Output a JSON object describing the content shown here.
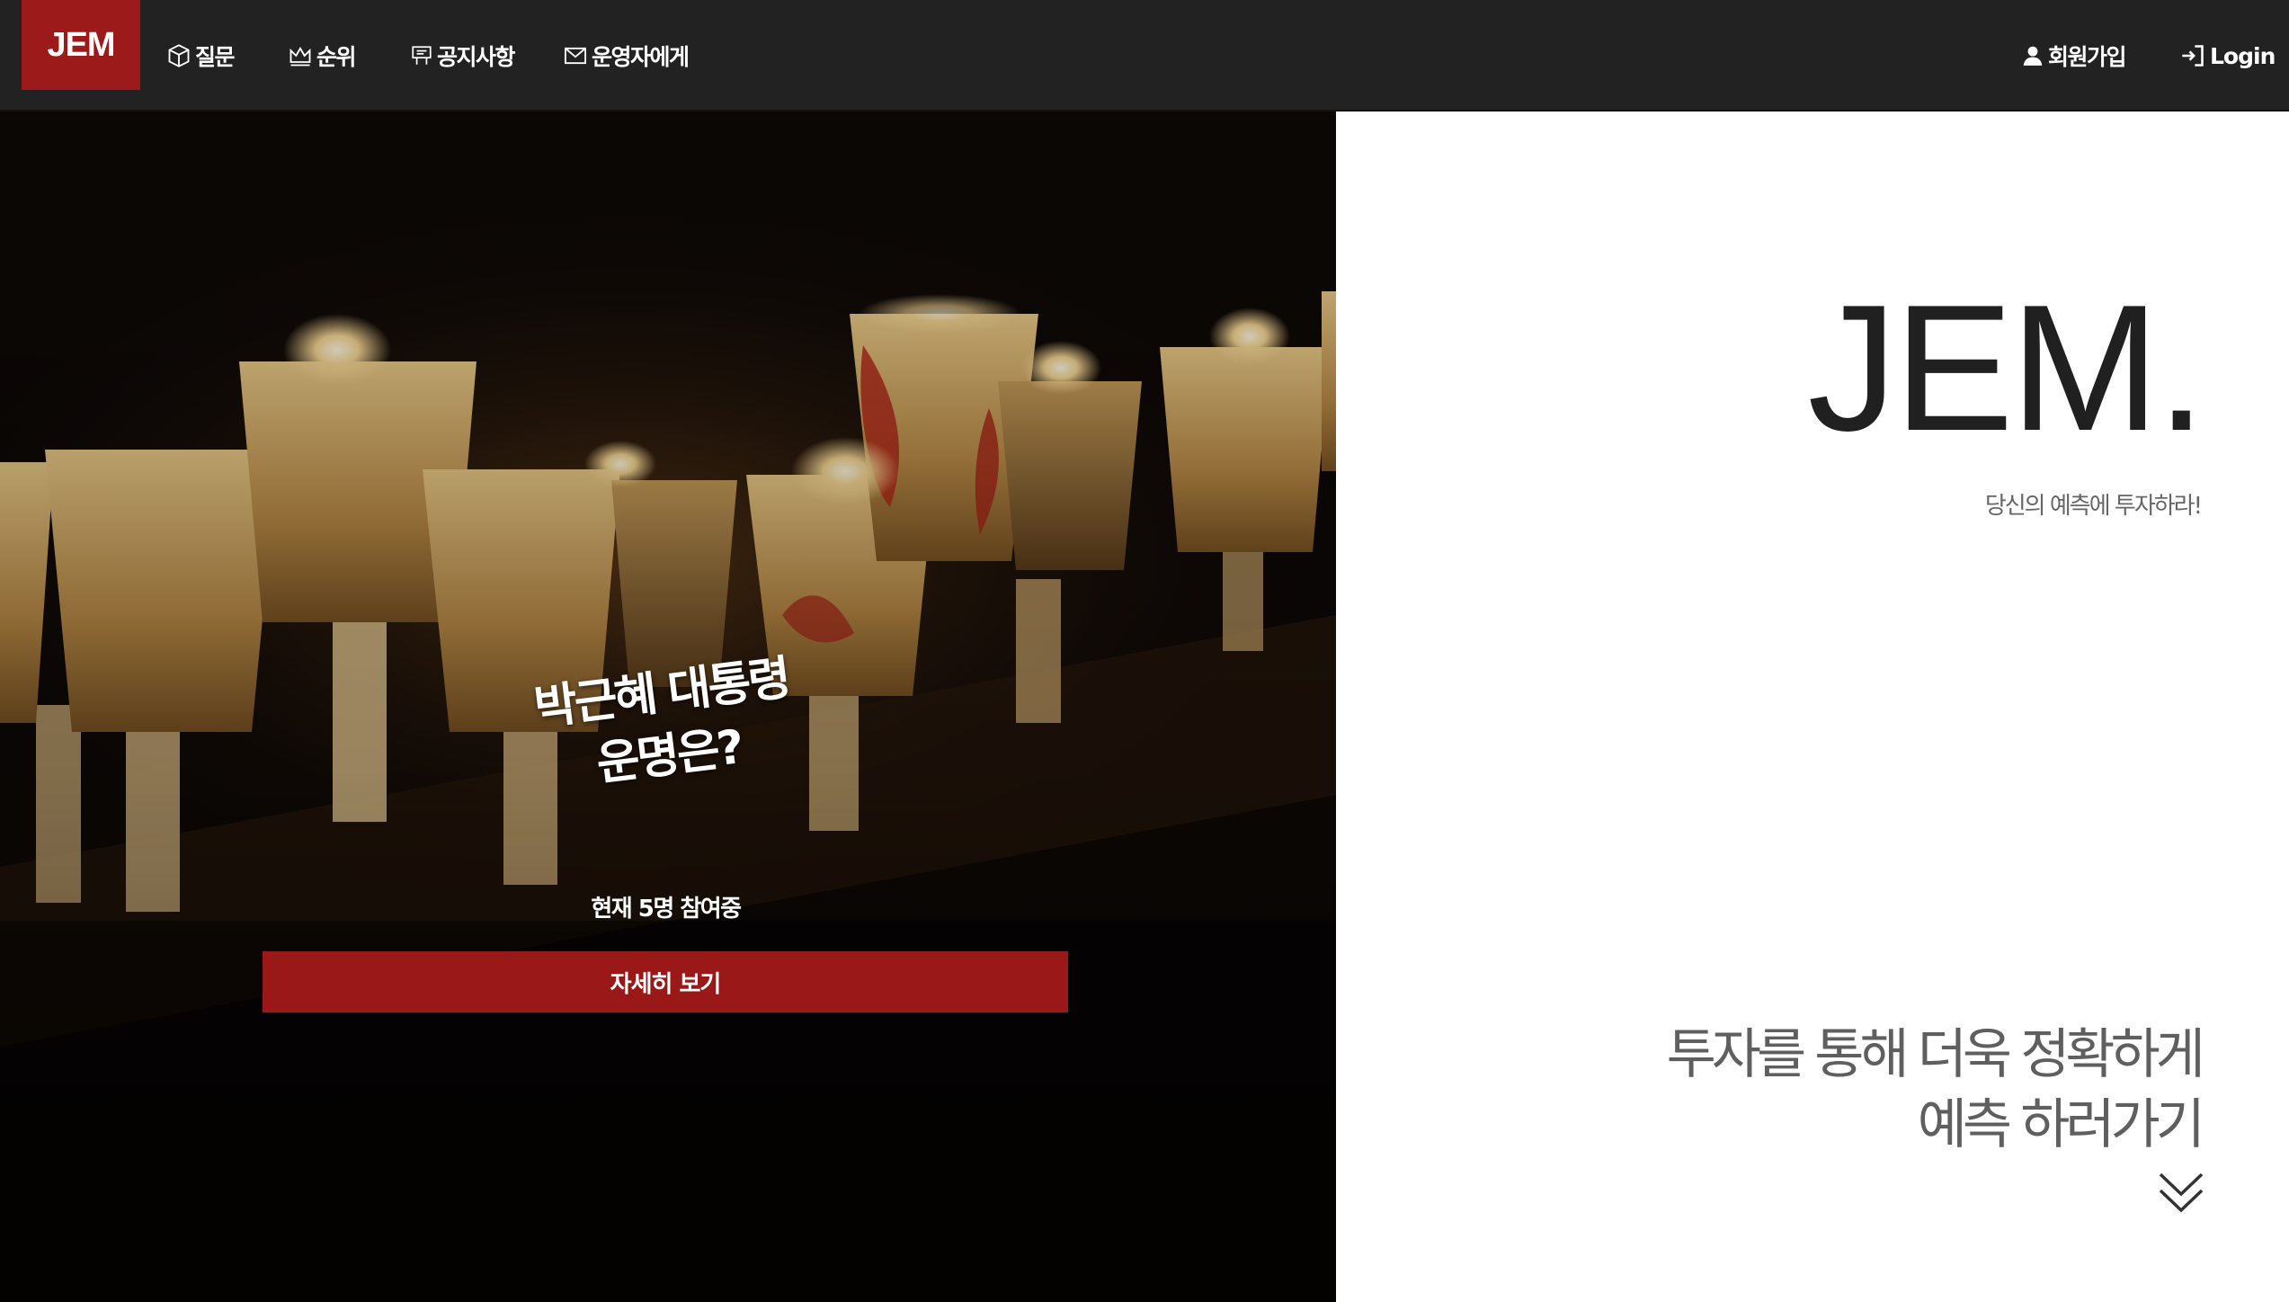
{
  "nav": {
    "brand": "JEM",
    "items": [
      {
        "icon": "cube-icon",
        "label": "질문"
      },
      {
        "icon": "crown-icon",
        "label": "순위"
      },
      {
        "icon": "noticeboard-icon",
        "label": "공지사항"
      },
      {
        "icon": "envelope-icon",
        "label": "운영자에게"
      }
    ],
    "signup": {
      "icon": "user-icon",
      "label": "회원가입"
    },
    "login": {
      "icon": "login-icon",
      "label": "Login"
    }
  },
  "hero": {
    "title_line1": "박근혜 대통령",
    "title_line2": "운명은?",
    "participants": "현재 5명 참여중",
    "button_label": "자세히 보기"
  },
  "panel": {
    "logo": "JEM.",
    "tagline": "당신의 예측에 투자하라!",
    "cta_line1": "투자를 통해 더욱 정확하게",
    "cta_line2": "예측 하러가기",
    "scroll_icon": "double-chevron-down-icon"
  },
  "colors": {
    "accent": "#9a1818",
    "navbar": "#222222",
    "hero_bg": "#0b0706"
  }
}
